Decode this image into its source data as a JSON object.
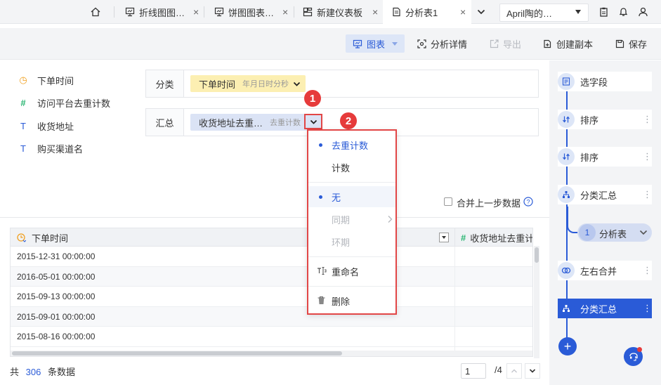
{
  "tabs": [
    {
      "label": "折线图图…"
    },
    {
      "label": "饼图图表…"
    },
    {
      "label": "新建仪表板"
    },
    {
      "label": "分析表1"
    }
  ],
  "user": {
    "name": "April陶的…"
  },
  "toolbar": {
    "chart": "图表",
    "analysis": "分析详情",
    "export": "导出",
    "copy": "创建副本",
    "save": "保存"
  },
  "fields": [
    {
      "icon": "◷",
      "label": "下单时间",
      "color": "#f0a020"
    },
    {
      "icon": "#",
      "label": "访问平台去重计数",
      "color": "#2bb673"
    },
    {
      "icon": "T",
      "label": "收货地址",
      "color": "#2a5bd7"
    },
    {
      "icon": "T",
      "label": "购买渠道名",
      "color": "#2a5bd7"
    }
  ],
  "config": {
    "category_label": "分类",
    "category_pill": "下单时间",
    "category_sub": "年月日时分秒",
    "summary_label": "汇总",
    "summary_pill": "收货地址去重…",
    "summary_sub": "去重计数"
  },
  "markers": [
    "1",
    "2"
  ],
  "menu": {
    "distinct": "去重计数",
    "count": "计数",
    "none": "无",
    "yoy": "同期",
    "mom": "环期",
    "rename": "重命名",
    "delete": "删除"
  },
  "merge_prev": "合并上一步数据",
  "table": {
    "col1": "下单时间",
    "col2": "收货地址去重计",
    "rows": [
      "2015-12-31 00:00:00",
      "2016-05-01 00:00:00",
      "2015-09-13 00:00:00",
      "2015-09-01 00:00:00",
      "2015-08-16 00:00:00"
    ]
  },
  "pipeline": {
    "select_fields": "选字段",
    "sort1": "排序",
    "sort2": "排序",
    "group1": "分类汇总",
    "sub_badge": "1",
    "sub_label": "分析表",
    "merge": "左右合并",
    "group2": "分类汇总"
  },
  "footer": {
    "total_prefix": "共",
    "total_count": "306",
    "total_suffix": "条数据",
    "page": "1",
    "page_total": "/4"
  },
  "colors": {
    "accent": "#2a5bd7",
    "marker": "#e63b3b"
  }
}
